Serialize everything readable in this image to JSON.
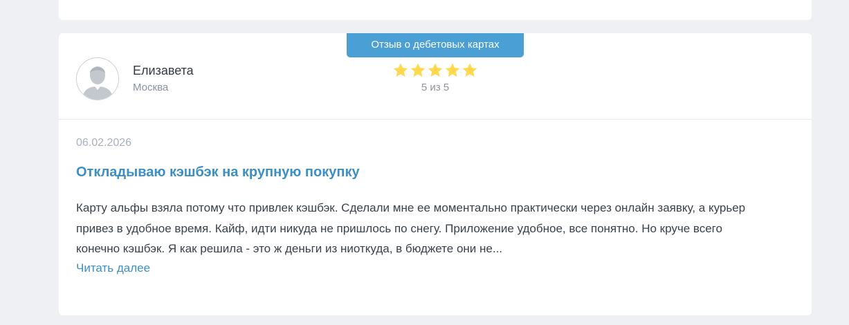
{
  "review": {
    "category_badge": "Отзыв о дебетовых картах",
    "author": {
      "name": "Елизавета",
      "city": "Москва"
    },
    "rating": {
      "stars": 5,
      "max": 5,
      "text": "5 из 5"
    },
    "date": "06.02.2026",
    "title": "Откладываю кэшбэк на крупную покупку",
    "text": "Карту альфы взяла потому что привлек кэшбэк. Сделали мне ее моментально практически через онлайн заявку, а курьер привез в удобное время. Кайф, идти никуда не пришлось по снегу. Приложение удобное, все понятно. Но круче всего конечно кэшбэк. Я как решила - это ж деньги из ниоткуда, в бюджете они не...",
    "read_more": "Читать далее"
  },
  "colors": {
    "accent": "#4a9fd5",
    "link": "#3b8fc4",
    "star": "#ffd84d",
    "background": "#eef0f3"
  },
  "icons": {
    "avatar": "user-avatar-placeholder-icon",
    "star": "star-icon"
  }
}
